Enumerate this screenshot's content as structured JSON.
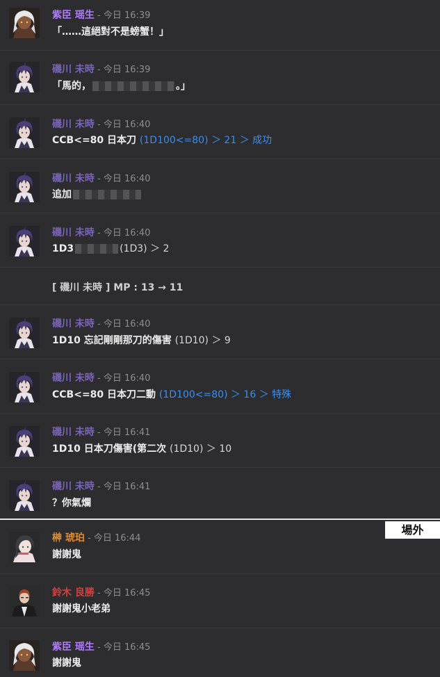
{
  "colors": {
    "name_shiomi": "#b07bff",
    "name_isokawa": "#7a64b8",
    "name_sakaki": "#e08a2c",
    "name_suzuki": "#d0413e",
    "dice": "#3b8ef0"
  },
  "messages": [
    {
      "id": "m1",
      "speaker": "紫臣 瑶生",
      "time": "- 今日 16:39",
      "segments": [
        {
          "t": "「……這絕對不是螃蟹！」",
          "k": "text"
        }
      ],
      "avatar": "shiomi"
    },
    {
      "id": "m2",
      "speaker": "磯川 未時",
      "time": "- 今日 16:39",
      "segments": [
        {
          "t": "「馬的，",
          "k": "text"
        },
        {
          "k": "mosaic",
          "w": 118
        },
        {
          "t": "。」",
          "k": "text"
        }
      ],
      "avatar": "isokawa"
    },
    {
      "id": "m3",
      "speaker": "磯川 未時",
      "time": "- 今日 16:40",
      "segments": [
        {
          "t": "CCB<=80 日本刀 ",
          "k": "text"
        },
        {
          "t": "(1D100<=80) ＞ 21 ＞ 成功",
          "k": "dice"
        }
      ],
      "avatar": "isokawa"
    },
    {
      "id": "m4",
      "speaker": "磯川 未時",
      "time": "- 今日 16:40",
      "segments": [
        {
          "t": "追加",
          "k": "text"
        },
        {
          "k": "mosaic",
          "w": 98
        }
      ],
      "avatar": "isokawa"
    },
    {
      "id": "m5",
      "speaker": "磯川 未時",
      "time": "- 今日 16:40",
      "segments": [
        {
          "t": "1D3",
          "k": "text"
        },
        {
          "k": "mosaic",
          "w": 62
        },
        {
          "t": "(1D3) ＞ 2",
          "k": "plain"
        }
      ],
      "avatar": "isokawa"
    },
    {
      "id": "m6",
      "speaker": "",
      "time": "",
      "segments": [
        {
          "t": "[ 磯川 未時 ] MP : 13 → 11",
          "k": "text"
        }
      ],
      "avatar": "none"
    },
    {
      "id": "m7",
      "speaker": "磯川 未時",
      "time": "- 今日 16:40",
      "segments": [
        {
          "t": "1D10 忘記剛剛那刀的傷害 ",
          "k": "text"
        },
        {
          "t": "(1D10) ＞ 9",
          "k": "plain"
        }
      ],
      "avatar": "isokawa"
    },
    {
      "id": "m8",
      "speaker": "磯川 未時",
      "time": "- 今日 16:40",
      "segments": [
        {
          "t": "CCB<=80 日本刀二動 ",
          "k": "text"
        },
        {
          "t": "(1D100<=80) ＞ 16 ＞ 特殊",
          "k": "dice"
        }
      ],
      "avatar": "isokawa"
    },
    {
      "id": "m9",
      "speaker": "磯川 未時",
      "time": "- 今日 16:41",
      "segments": [
        {
          "t": "1D10 日本刀傷害(第二次 ",
          "k": "text"
        },
        {
          "t": "(1D10) ＞ 10",
          "k": "plain"
        }
      ],
      "avatar": "isokawa"
    },
    {
      "id": "m10",
      "speaker": "磯川 未時",
      "time": "- 今日 16:41",
      "segments": [
        {
          "t": "？你氣爛",
          "k": "text"
        }
      ],
      "avatar": "isokawa"
    },
    {
      "id": "m11",
      "speaker": "榊 琥珀",
      "time": "- 今日 16:44",
      "segments": [
        {
          "t": "謝謝鬼",
          "k": "text"
        }
      ],
      "avatar": "sakaki"
    },
    {
      "id": "m12",
      "speaker": "鈴木 良勝",
      "time": "- 今日 16:45",
      "segments": [
        {
          "t": "謝謝鬼小老弟",
          "k": "text"
        }
      ],
      "avatar": "suzuki"
    },
    {
      "id": "m13",
      "speaker": "紫臣 瑶生",
      "time": "- 今日 16:45",
      "segments": [
        {
          "t": "謝謝鬼",
          "k": "text"
        }
      ],
      "avatar": "shiomi"
    }
  ],
  "outside_tag": "場外"
}
